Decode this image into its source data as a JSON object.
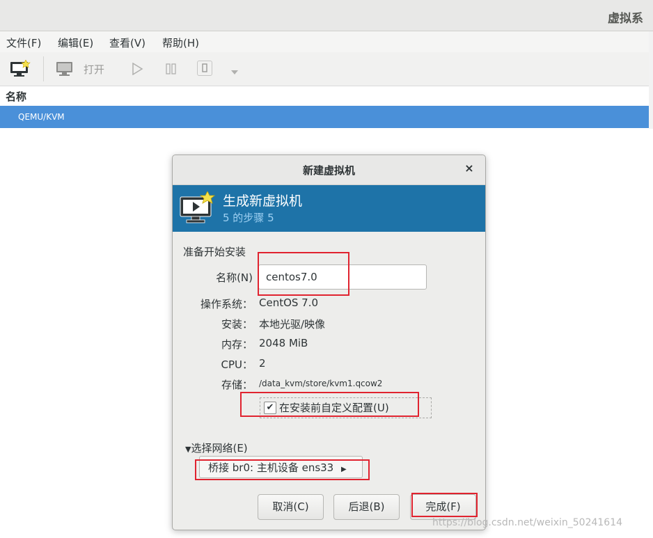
{
  "window": {
    "title": "虚拟系"
  },
  "menubar": {
    "items": [
      "文件(F)",
      "编辑(E)",
      "查看(V)",
      "帮助(H)"
    ]
  },
  "toolbar": {
    "open_label": "打开"
  },
  "list": {
    "column_header": "名称",
    "rows": [
      "QEMU/KVM"
    ]
  },
  "dialog": {
    "title": "新建虚拟机",
    "close_glyph": "×",
    "banner": {
      "title": "生成新虚拟机",
      "step": "5 的步骤 5"
    },
    "section_title": "准备开始安装",
    "name_label": "名称(N)",
    "name_value": "centos7.0",
    "fields": [
      {
        "label": "操作系统：",
        "value": "CentOS 7.0"
      },
      {
        "label": "安装：",
        "value": "本地光驱/映像"
      },
      {
        "label": "内存：",
        "value": "2048 MiB"
      },
      {
        "label": "CPU：",
        "value": "2"
      },
      {
        "label": "存储：",
        "value": "/data_kvm/store/kvm1.qcow2"
      }
    ],
    "customize": {
      "checked": true,
      "label": "在安装前自定义配置(U)"
    },
    "network": {
      "expander_label": "选择网络(E)",
      "selected": "桥接 br0: 主机设备 ens33"
    },
    "buttons": {
      "cancel": "取消(C)",
      "back": "后退(B)",
      "finish": "完成(F)"
    }
  },
  "watermark": "https://blog.csdn.net/weixin_50241614",
  "colors": {
    "selection": "#4a90d9",
    "banner": "#1e73a8",
    "highlight_annotation": "#e0232f"
  }
}
